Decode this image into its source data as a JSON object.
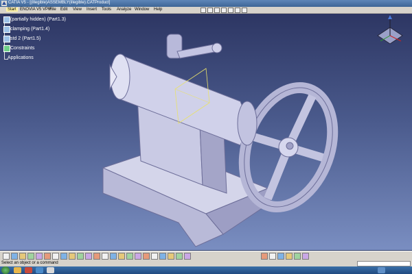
{
  "window": {
    "title": "CATIA V5 - [(illegible)ASSEMBLY(illegible).CATProduct]"
  },
  "menu": {
    "items": [
      "Start",
      "ENOVIA V5 VPM",
      "File",
      "Edit",
      "View",
      "Insert",
      "Tools",
      "Analyze",
      "Window",
      "Help"
    ]
  },
  "tree": {
    "items": [
      {
        "label": "(partially hidden) (Part1.3)",
        "icon": "part-icon"
      },
      {
        "label": "clamping (Part1.4)",
        "icon": "part-icon"
      },
      {
        "label": "std 2 (Part1.5)",
        "icon": "part-icon"
      },
      {
        "label": "Constraints",
        "icon": "constraints-icon"
      },
      {
        "label": "Applications",
        "icon": "applications-icon"
      }
    ]
  },
  "status": {
    "message": "Select an object or a command"
  },
  "colors": {
    "background_top": "#2d3663",
    "background_bottom": "#7a8ec1",
    "model": "#c8c9e2",
    "model_shadow": "#8f90b8",
    "menubar": "#d7d3cb"
  },
  "toolbar": {
    "icons": [
      "new-icon",
      "open-icon",
      "save-icon",
      "print-icon",
      "cut-icon",
      "copy-icon",
      "paste-icon",
      "undo-icon",
      "redo-icon",
      "pointer-icon",
      "fly-icon",
      "fit-all-icon",
      "pan-icon",
      "rotate-icon",
      "zoom-in-icon",
      "zoom-out-icon",
      "normal-view-icon",
      "multi-view-icon",
      "iso-view-icon",
      "shading-icon",
      "hide-show-icon",
      "swap-space-icon",
      "measure-icon",
      "material-icon",
      "axis-icon",
      "plane-icon",
      "constraint-icon",
      "knowledge-icon",
      "render-icon"
    ]
  }
}
